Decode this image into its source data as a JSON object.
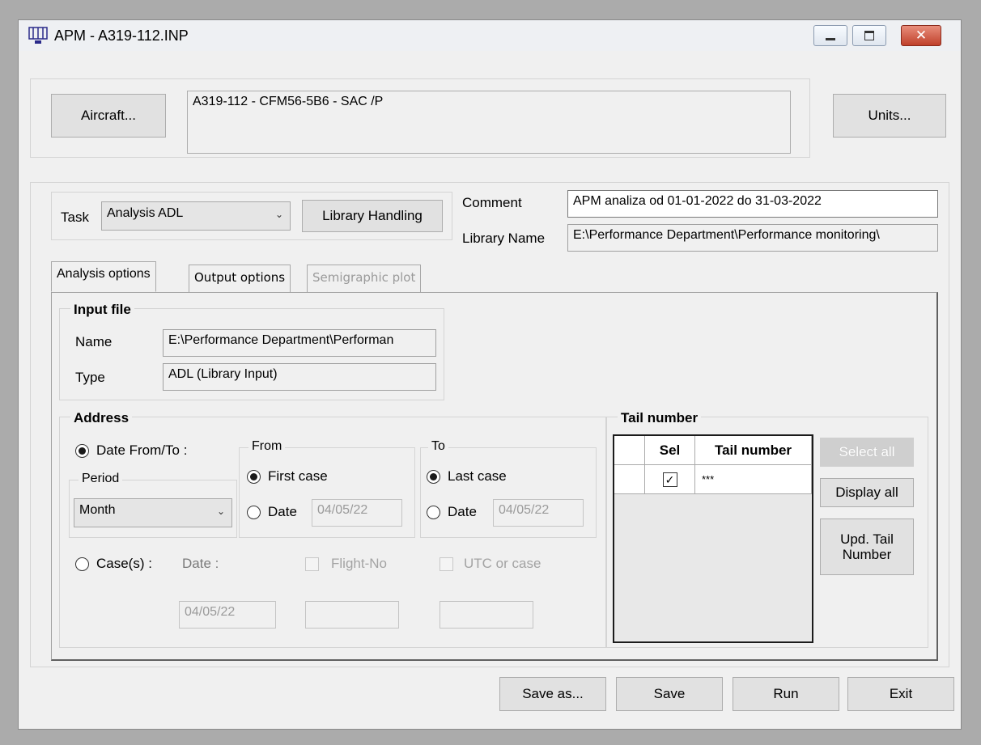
{
  "window": {
    "title": "APM - A319-112.INP",
    "minimize_icon": "minimize-icon",
    "maximize_icon": "maximize-icon",
    "close_icon": "close-icon"
  },
  "top": {
    "aircraft_button": "Aircraft...",
    "aircraft_description": "A319-112 - CFM56-5B6 -  SAC /P",
    "units_button": "Units..."
  },
  "task": {
    "label": "Task",
    "selected": "Analysis ADL",
    "library_button": "Library Handling",
    "comment_label": "Comment",
    "comment_value": "APM analiza od 01-01-2022 do 31-03-2022",
    "library_name_label": "Library Name",
    "library_name_value": "E:\\Performance Department\\Performance monitoring\\"
  },
  "tabs": [
    "Analysis options",
    "Output options",
    "Semigraphic plot"
  ],
  "input_file": {
    "title": "Input file",
    "name_label": "Name",
    "name_value": "E:\\Performance Department\\Performan",
    "type_label": "Type",
    "type_value": "ADL (Library Input)"
  },
  "address": {
    "title": "Address",
    "date_from_to": "Date From/To :",
    "period_label": "Period",
    "period_value": "Month",
    "from_label": "From",
    "first_case": "First case",
    "from_date_label": "Date",
    "from_date_value": "04/05/22",
    "to_label": "To",
    "last_case": "Last case",
    "to_date_label": "Date",
    "to_date_value": "04/05/22",
    "cases_label": "Case(s) :",
    "cases_date_label": "Date :",
    "flight_no_label": "Flight-No",
    "utc_label": "UTC or case",
    "cases_date_value": "04/05/22"
  },
  "tail_number": {
    "title": "Tail number",
    "col_sel": "Sel",
    "col_tail": "Tail number",
    "rows": [
      {
        "sel": true,
        "tail": "***"
      }
    ],
    "select_all": "Select all",
    "display_all": "Display all",
    "upd_tail_1": "Upd. Tail",
    "upd_tail_2": "Number"
  },
  "bottom": {
    "save_as": "Save as...",
    "save": "Save",
    "run": "Run",
    "exit": "Exit"
  }
}
